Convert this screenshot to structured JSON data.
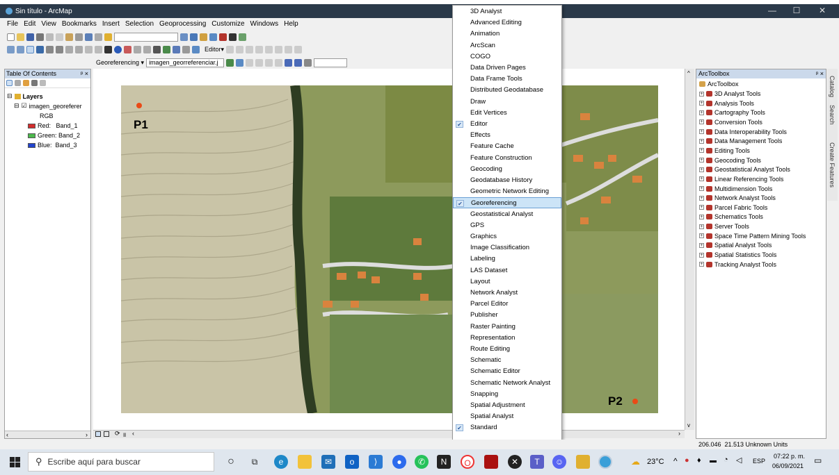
{
  "window": {
    "title": "Sin título - ArcMap",
    "controls": [
      "—",
      "☐",
      "✕"
    ]
  },
  "menu": [
    "File",
    "Edit",
    "View",
    "Bookmarks",
    "Insert",
    "Selection",
    "Geoprocessing",
    "Customize",
    "Windows",
    "Help"
  ],
  "toolbar": {
    "editor_label": "Editor▾"
  },
  "georef_toolbar": {
    "label": "Georeferencing ▾",
    "layer": "imagen_georreferenciar.j"
  },
  "toc": {
    "title": "Table Of Contents",
    "layers_label": "Layers",
    "layer_name": "imagen_georeferer",
    "render_label": "RGB",
    "bands": [
      {
        "label": "Red:   Band_1",
        "color": "#d22c2c"
      },
      {
        "label": "Green: Band_2",
        "color": "#4cb84c"
      },
      {
        "label": "Blue:  Band_3",
        "color": "#2244cc"
      }
    ]
  },
  "map": {
    "point1": "P1",
    "point2": "P2",
    "point_color": "#ea4a16"
  },
  "dropdown": {
    "items": [
      {
        "label": "3D Analyst",
        "checked": false
      },
      {
        "label": "Advanced Editing",
        "checked": false
      },
      {
        "label": "Animation",
        "checked": false
      },
      {
        "label": "ArcScan",
        "checked": false
      },
      {
        "label": "COGO",
        "checked": false
      },
      {
        "label": "Data Driven Pages",
        "checked": false
      },
      {
        "label": "Data Frame Tools",
        "checked": false
      },
      {
        "label": "Distributed Geodatabase",
        "checked": false
      },
      {
        "label": "Draw",
        "checked": false
      },
      {
        "label": "Edit Vertices",
        "checked": false
      },
      {
        "label": "Editor",
        "checked": true
      },
      {
        "label": "Effects",
        "checked": false
      },
      {
        "label": "Feature Cache",
        "checked": false
      },
      {
        "label": "Feature Construction",
        "checked": false
      },
      {
        "label": "Geocoding",
        "checked": false
      },
      {
        "label": "Geodatabase History",
        "checked": false
      },
      {
        "label": "Geometric Network Editing",
        "checked": false
      },
      {
        "label": "Georeferencing",
        "checked": true,
        "selected": true
      },
      {
        "label": "Geostatistical Analyst",
        "checked": false
      },
      {
        "label": "GPS",
        "checked": false
      },
      {
        "label": "Graphics",
        "checked": false
      },
      {
        "label": "Image Classification",
        "checked": false
      },
      {
        "label": "Labeling",
        "checked": false
      },
      {
        "label": "LAS Dataset",
        "checked": false
      },
      {
        "label": "Layout",
        "checked": false
      },
      {
        "label": "Network Analyst",
        "checked": false
      },
      {
        "label": "Parcel Editor",
        "checked": false
      },
      {
        "label": "Publisher",
        "checked": false
      },
      {
        "label": "Raster Painting",
        "checked": false
      },
      {
        "label": "Representation",
        "checked": false
      },
      {
        "label": "Route Editing",
        "checked": false
      },
      {
        "label": "Schematic",
        "checked": false
      },
      {
        "label": "Schematic Editor",
        "checked": false
      },
      {
        "label": "Schematic Network Analyst",
        "checked": false
      },
      {
        "label": "Snapping",
        "checked": false
      },
      {
        "label": "Spatial Adjustment",
        "checked": false
      },
      {
        "label": "Spatial Analyst",
        "checked": false
      },
      {
        "label": "Standard",
        "checked": true
      }
    ],
    "more": "▾"
  },
  "toolbox": {
    "title": "ArcToolbox",
    "root": "ArcToolbox",
    "items": [
      "3D Analyst Tools",
      "Analysis Tools",
      "Cartography Tools",
      "Conversion Tools",
      "Data Interoperability Tools",
      "Data Management Tools",
      "Editing Tools",
      "Geocoding Tools",
      "Geostatistical Analyst Tools",
      "Linear Referencing Tools",
      "Multidimension Tools",
      "Network Analyst Tools",
      "Parcel Fabric Tools",
      "Schematics Tools",
      "Server Tools",
      "Space Time Pattern Mining Tools",
      "Spatial Analyst Tools",
      "Spatial Statistics Tools",
      "Tracking Analyst Tools"
    ]
  },
  "side_tabs": [
    "Catalog",
    "Search",
    "Create Features"
  ],
  "status": {
    "coords": "206.046  21.513 Unknown Units"
  },
  "taskbar": {
    "search_placeholder": "Escribe aquí para buscar",
    "weather": "23°C",
    "lang": "ESP",
    "time": "07:22 p. m.",
    "date": "06/09/2021"
  }
}
